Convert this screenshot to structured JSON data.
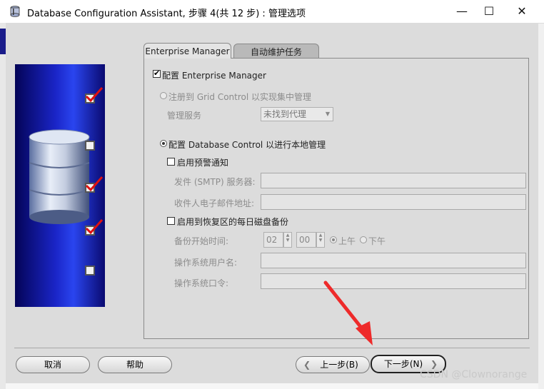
{
  "window": {
    "title": "Database Configuration Assistant, 步骤 4(共 12 步) : 管理选项",
    "minimize_glyph": "—",
    "maximize_glyph": "☐",
    "close_glyph": "✕"
  },
  "steps": [
    {
      "state": "done"
    },
    {
      "state": "pending"
    },
    {
      "state": "done"
    },
    {
      "state": "done"
    },
    {
      "state": "pending"
    }
  ],
  "tabs": [
    {
      "label": "Enterprise Manager",
      "active": true
    },
    {
      "label": "自动维护任务",
      "active": false
    }
  ],
  "em": {
    "configure_em": {
      "label": "配置 Enterprise Manager",
      "checked": true
    },
    "grid_control": {
      "label": "注册到 Grid Control 以实现集中管理",
      "selected": false,
      "enabled": false
    },
    "mgmt_service": {
      "label": "管理服务",
      "value": "未找到代理"
    },
    "db_control": {
      "label": "配置 Database Control 以进行本地管理",
      "selected": true
    },
    "alert_notify": {
      "label": "启用预警通知",
      "checked": false
    },
    "smtp_server": {
      "label": "发件 (SMTP) 服务器:",
      "value": ""
    },
    "recipient_email": {
      "label": "收件人电子邮件地址:",
      "value": ""
    },
    "daily_backup": {
      "label": "启用到恢复区的每日磁盘备份",
      "checked": false
    },
    "backup_time": {
      "label": "备份开始时间:",
      "hour": "02",
      "minute": "00",
      "am": "上午",
      "pm": "下午",
      "selected": "am"
    },
    "os_user": {
      "label": "操作系统用户名:",
      "value": ""
    },
    "os_password": {
      "label": "操作系统口令:",
      "value": ""
    }
  },
  "buttons": {
    "cancel": "取消",
    "help": "帮助",
    "back": "上一步(B)",
    "next": "下一步(N)"
  },
  "watermark": "CSDN @Clownorange"
}
